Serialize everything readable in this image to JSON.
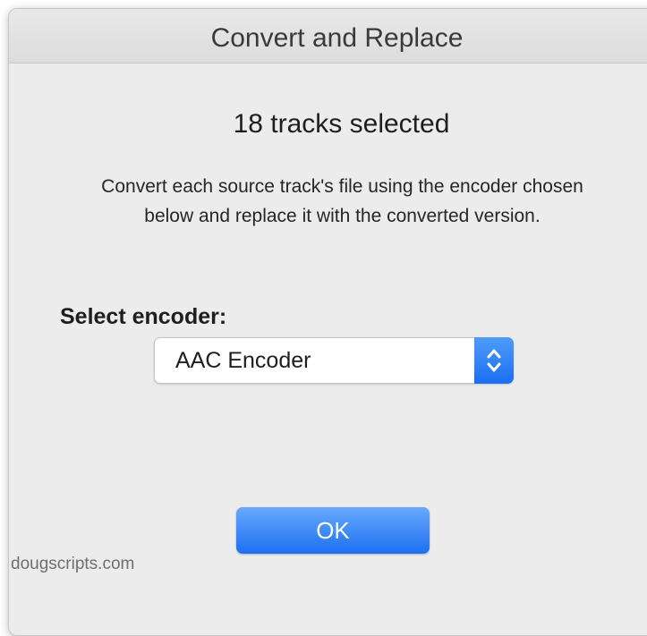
{
  "dialog": {
    "title": "Convert and Replace",
    "heading": "18 tracks selected",
    "description": "Convert each source track's file using the encoder chosen below and replace it with the converted version.",
    "select_label": "Select encoder:",
    "encoder": {
      "selected": "AAC Encoder",
      "stepper_icon": "up-down-chevron-icon"
    },
    "ok_button": "OK",
    "accent": "#1b6ff0"
  },
  "footer": {
    "watermark": "dougscripts.com"
  }
}
